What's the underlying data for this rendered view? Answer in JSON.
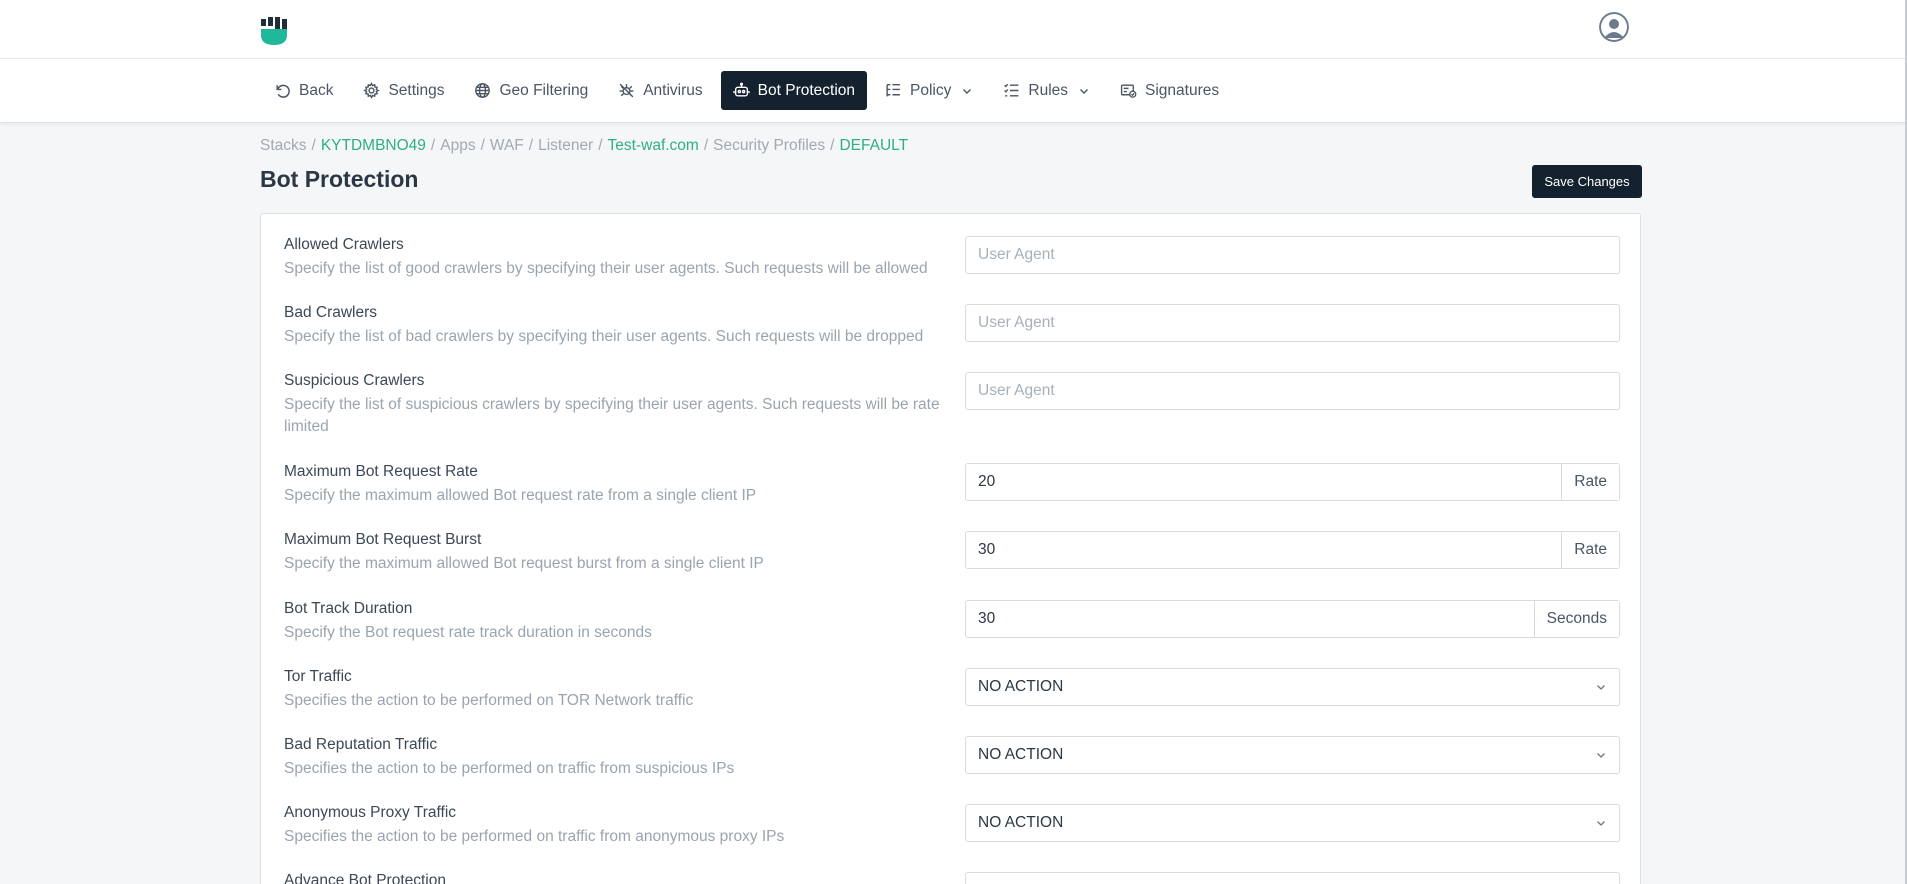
{
  "nav": {
    "items": [
      {
        "label": "Back",
        "icon": "back-icon"
      },
      {
        "label": "Settings",
        "icon": "gear-icon"
      },
      {
        "label": "Geo Filtering",
        "icon": "globe-icon"
      },
      {
        "label": "Antivirus",
        "icon": "antivirus-icon"
      },
      {
        "label": "Bot Protection",
        "icon": "robot-icon",
        "active": true
      },
      {
        "label": "Policy",
        "icon": "policy-icon",
        "dropdown": true
      },
      {
        "label": "Rules",
        "icon": "rules-icon",
        "dropdown": true
      },
      {
        "label": "Signatures",
        "icon": "signatures-icon"
      }
    ]
  },
  "breadcrumb": [
    {
      "text": "Stacks",
      "link": false
    },
    {
      "text": "KYTDMBNO49",
      "link": true
    },
    {
      "text": "Apps",
      "link": false
    },
    {
      "text": "WAF",
      "link": false
    },
    {
      "text": "Listener",
      "link": false
    },
    {
      "text": "Test-waf.com",
      "link": true
    },
    {
      "text": "Security Profiles",
      "link": false
    },
    {
      "text": "DEFAULT",
      "link": true
    }
  ],
  "page": {
    "title": "Bot Protection",
    "save_label": "Save Changes"
  },
  "form": {
    "allowed_crawlers": {
      "label": "Allowed Crawlers",
      "desc": "Specify the list of good crawlers by specifying their user agents. Such requests will be allowed",
      "placeholder": "User Agent",
      "value": ""
    },
    "bad_crawlers": {
      "label": "Bad Crawlers",
      "desc": "Specify the list of bad crawlers by specifying their user agents. Such requests will be dropped",
      "placeholder": "User Agent",
      "value": ""
    },
    "suspicious_crawlers": {
      "label": "Suspicious Crawlers",
      "desc": "Specify the list of suspicious crawlers by specifying their user agents. Such requests will be rate limited",
      "placeholder": "User Agent",
      "value": ""
    },
    "max_rate": {
      "label": "Maximum Bot Request Rate",
      "desc": "Specify the maximum allowed Bot request rate from a single client IP",
      "value": "20",
      "unit": "Rate"
    },
    "max_burst": {
      "label": "Maximum Bot Request Burst",
      "desc": "Specify the maximum allowed Bot request burst from a single client IP",
      "value": "30",
      "unit": "Rate"
    },
    "track_duration": {
      "label": "Bot Track Duration",
      "desc": "Specify the Bot request rate track duration in seconds",
      "value": "30",
      "unit": "Seconds"
    },
    "tor_traffic": {
      "label": "Tor Traffic",
      "desc": "Specifies the action to be performed on TOR Network traffic",
      "value": "NO ACTION"
    },
    "bad_reputation": {
      "label": "Bad Reputation Traffic",
      "desc": "Specifies the action to be performed on traffic from suspicious IPs",
      "value": "NO ACTION"
    },
    "anonymous_proxy": {
      "label": "Anonymous Proxy Traffic",
      "desc": "Specifies the action to be performed on traffic from anonymous proxy IPs",
      "value": "NO ACTION"
    },
    "advance_bot": {
      "label": "Advance Bot Protection"
    }
  },
  "colors": {
    "accent": "#2fae8a",
    "dark": "#14212e",
    "logo": "#1fb89a"
  }
}
